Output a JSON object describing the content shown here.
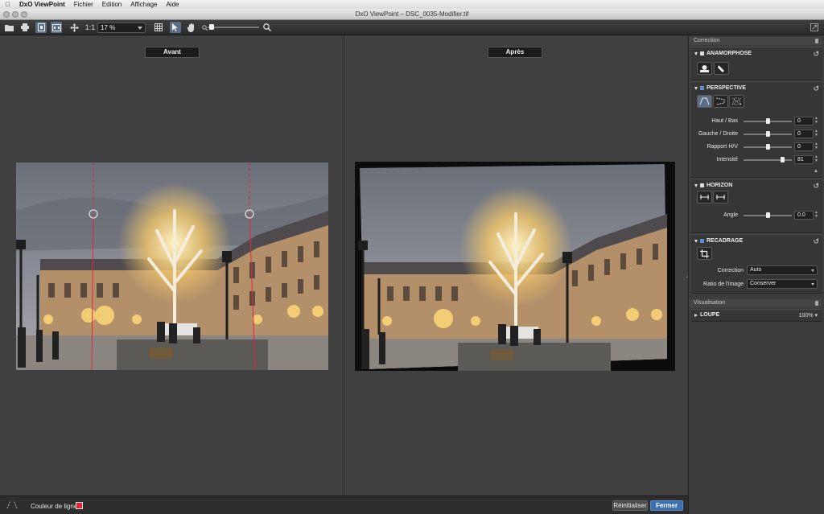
{
  "menubar": {
    "app_name": "DxO ViewPoint",
    "items": [
      "Fichier",
      "Edition",
      "Affichage",
      "Aide"
    ]
  },
  "window": {
    "title": "DxO ViewPoint – DSC_0035-Modifier.tif"
  },
  "toolbar": {
    "one_to_one_label": "1:1",
    "zoom_value": "17 %",
    "icons": [
      "folder-icon",
      "print-icon",
      "single-view-icon",
      "before-after-icon",
      "move-icon",
      "grid-icon",
      "pointer-icon",
      "hand-icon",
      "zoom-out-icon",
      "zoom-in-icon",
      "fullscreen-icon"
    ]
  },
  "viewer": {
    "before_label": "Avant",
    "after_label": "Après"
  },
  "bottombar": {
    "line_color_label": "Couleur de ligne",
    "line_color": "#e0263a",
    "reset_label": "Réinitialiser",
    "close_label": "Fermer"
  },
  "panel": {
    "correction_header": "Correction",
    "anamorphose": {
      "title": "ANAMORPHOSE"
    },
    "perspective": {
      "title": "PERSPECTIVE",
      "params": [
        {
          "label": "Haut / Bas",
          "value": "0",
          "level": 0.5
        },
        {
          "label": "Gauche / Droite",
          "value": "0",
          "level": 0.5
        },
        {
          "label": "Rapport H/V",
          "value": "0",
          "level": 0.5
        },
        {
          "label": "Intensité",
          "value": "81",
          "level": 0.81
        }
      ]
    },
    "horizon": {
      "title": "HORIZON",
      "angle_label": "Angle",
      "angle_value": "0.0",
      "angle_level": 0.5
    },
    "recadrage": {
      "title": "RECADRAGE",
      "correction_label": "Correction",
      "correction_value": "Auto",
      "ratio_label": "Ratio de l'image",
      "ratio_value": "Conserver"
    },
    "visualisation_header": "Visualisation",
    "loupe": {
      "title": "LOUPE",
      "value": "100%"
    }
  },
  "colors": {
    "accent_blue": "#3c6fae",
    "active_tool": "#5a6f86",
    "guide_line": "#e0263a"
  }
}
